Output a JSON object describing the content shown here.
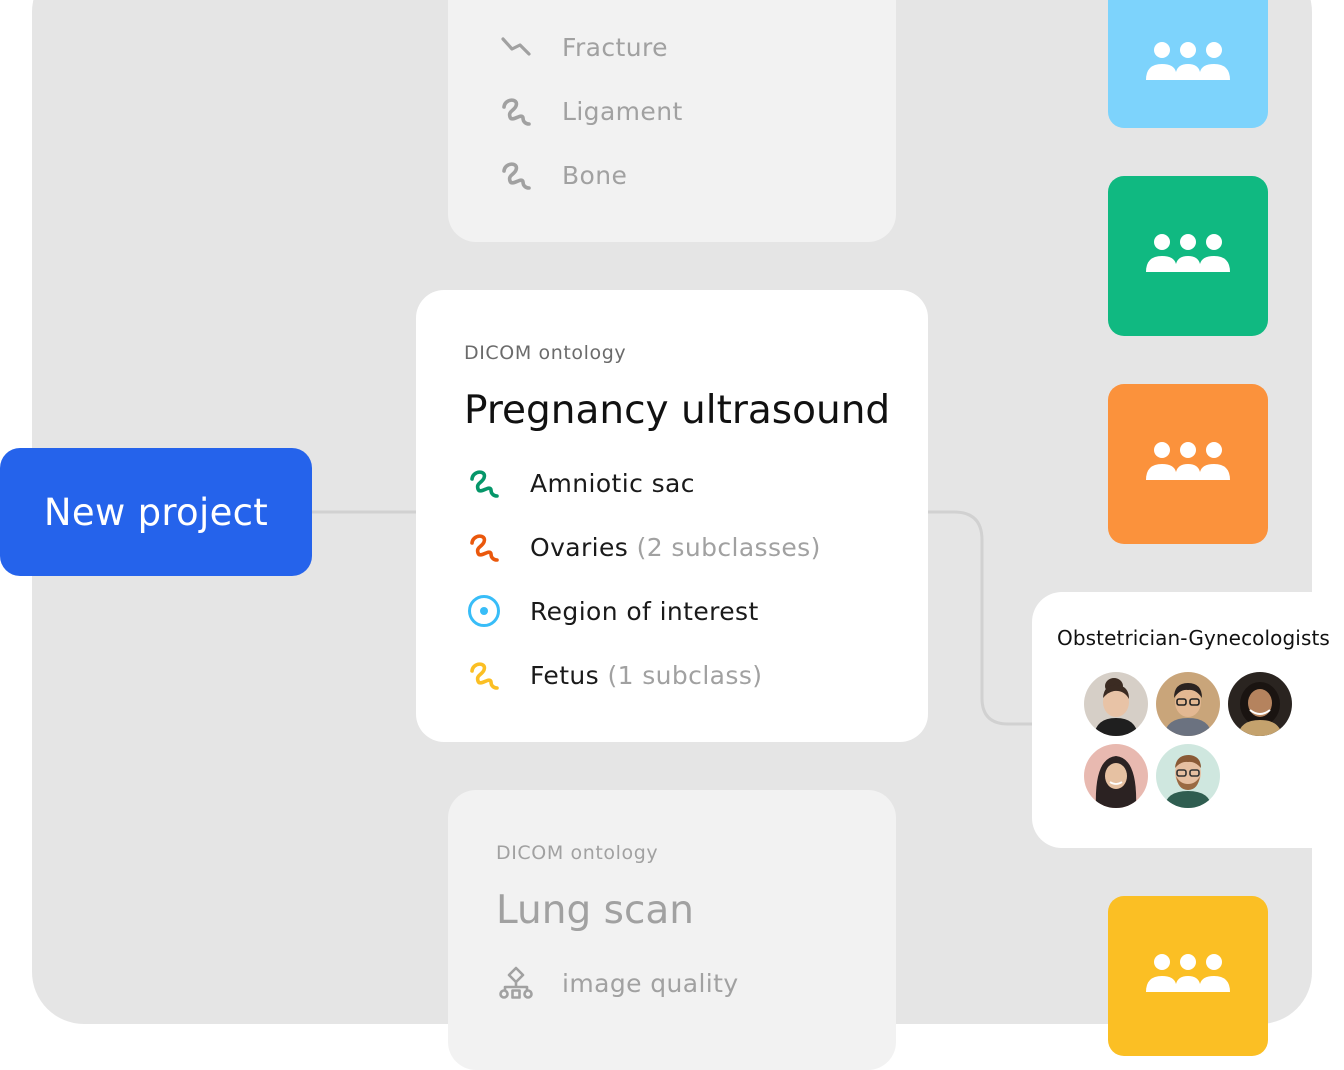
{
  "top_card": {
    "items": [
      {
        "label": "Fracture",
        "icon": "polyline-icon"
      },
      {
        "label": "Ligament",
        "icon": "squiggle-icon"
      },
      {
        "label": "Bone",
        "icon": "squiggle-icon"
      }
    ]
  },
  "new_project": {
    "label": "New project"
  },
  "main_card": {
    "kicker": "DICOM ontology",
    "title": "Pregnancy ultrasound",
    "items": [
      {
        "label": "Amniotic sac",
        "sub": "",
        "icon": "squiggle-icon",
        "color": "#059669"
      },
      {
        "label": "Ovaries",
        "sub": "(2 subclasses)",
        "icon": "squiggle-icon",
        "color": "#ea580c"
      },
      {
        "label": "Region of interest",
        "sub": "",
        "icon": "point-icon",
        "color": "#38bdf8"
      },
      {
        "label": "Fetus",
        "sub": "(1 subclass)",
        "icon": "squiggle-icon",
        "color": "#fbbf24"
      }
    ]
  },
  "bottom_card": {
    "kicker": "DICOM ontology",
    "title": "Lung scan",
    "items": [
      {
        "label": "image quality",
        "icon": "hierarchy-icon"
      }
    ]
  },
  "team_tiles": [
    {
      "color": "#7dd3fc",
      "icon": "team-icon"
    },
    {
      "color": "#10b981",
      "icon": "team-icon"
    },
    {
      "color": "#fb923c",
      "icon": "team-icon"
    },
    {
      "color": "#fbbf24",
      "icon": "team-icon"
    }
  ],
  "team_card": {
    "name": "Obstetrician-Gynecologists",
    "members": [
      {
        "icon": "avatar-woman-bun"
      },
      {
        "icon": "avatar-man-glasses"
      },
      {
        "icon": "avatar-woman-curly"
      },
      {
        "icon": "avatar-woman-hijab"
      },
      {
        "icon": "avatar-man-beard"
      }
    ]
  }
}
